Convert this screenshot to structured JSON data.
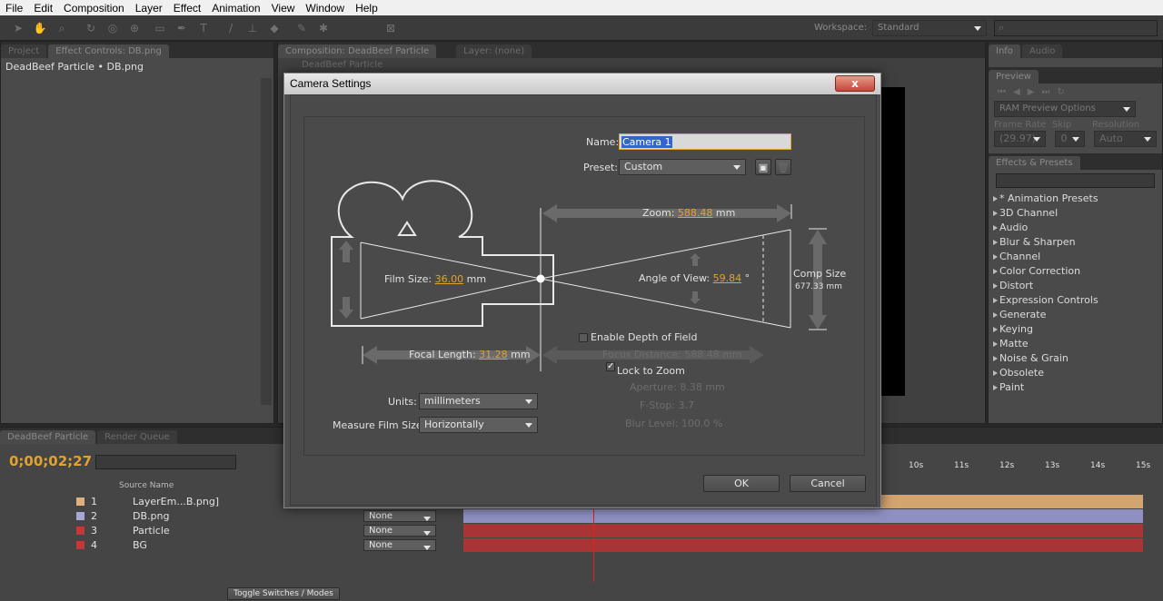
{
  "menu": [
    "File",
    "Edit",
    "Composition",
    "Layer",
    "Effect",
    "Animation",
    "View",
    "Window",
    "Help"
  ],
  "workspace": {
    "label": "Workspace:",
    "value": "Standard"
  },
  "left_panel": {
    "tabs": [
      "Project",
      "Effect Controls: DB.png"
    ],
    "header": "DeadBeef Particle • DB.png"
  },
  "comp_panel": {
    "tabs": [
      "Composition: DeadBeef Particle",
      "Layer: (none)"
    ],
    "subtitle": "DeadBeef Particle"
  },
  "right_panel": {
    "tabs": [
      "Info",
      "Audio"
    ],
    "preview_title": "Preview",
    "ram_preview": "RAM Preview Options",
    "frame_rate_label": "Frame Rate",
    "skip_label": "Skip",
    "resolution_label": "Resolution",
    "frame_rate": "(29.97)",
    "skip": "0",
    "resolution": "Auto",
    "effects_title": "Effects & Presets",
    "effects": [
      "* Animation Presets",
      "3D Channel",
      "Audio",
      "Blur & Sharpen",
      "Channel",
      "Color Correction",
      "Distort",
      "Expression Controls",
      "Generate",
      "Keying",
      "Matte",
      "Noise & Grain",
      "Obsolete",
      "Paint"
    ]
  },
  "dialog": {
    "title": "Camera Settings",
    "close": "x",
    "name_label": "Name:",
    "name_value": "Camera 1",
    "preset_label": "Preset:",
    "preset_value": "Custom",
    "zoom_label": "Zoom:",
    "zoom_value": "588.48",
    "zoom_unit": "mm",
    "film_size_label": "Film Size:",
    "film_size_value": "36.00",
    "film_size_unit": "mm",
    "angle_label": "Angle of View:",
    "angle_value": "59.84",
    "angle_unit": "°",
    "comp_size_label": "Comp Size",
    "comp_size_value": "677.33 mm",
    "enable_dof_label": "Enable Depth of Field",
    "enable_dof_checked": false,
    "focal_length_label": "Focal Length:",
    "focal_length_value": "31.28",
    "focal_length_unit": "mm",
    "focus_distance_label": "Focus Distance:",
    "focus_distance_value": "588.48 mm",
    "lock_zoom_label": "Lock to Zoom",
    "lock_zoom_checked": true,
    "aperture_label": "Aperture:",
    "aperture_value": "8.38 mm",
    "fstop_label": "F-Stop:",
    "fstop_value": "3.7",
    "blur_label": "Blur Level:",
    "blur_value": "100.0 %",
    "units_label": "Units:",
    "units_value": "millimeters",
    "measure_label": "Measure Film Size:",
    "measure_value": "Horizontally",
    "ok": "OK",
    "cancel": "Cancel"
  },
  "timeline": {
    "tabs": [
      "DeadBeef Particle",
      "Render Queue"
    ],
    "timecode": "0;00;02;27",
    "source_header": "Source Name",
    "ruler": [
      "10s",
      "11s",
      "12s",
      "13s",
      "14s",
      "15s"
    ],
    "toggle": "Toggle Switches / Modes",
    "layers": [
      {
        "num": "1",
        "name": "LayerEm...B.png]",
        "mode": "",
        "color": "#e0b080"
      },
      {
        "num": "2",
        "name": "DB.png",
        "mode": "None",
        "color": "#a7a7d4"
      },
      {
        "num": "3",
        "name": "Particle",
        "mode": "None",
        "color": "#c03a3a"
      },
      {
        "num": "4",
        "name": "BG",
        "mode": "None",
        "color": "#c03a3a"
      }
    ],
    "bar_colors": [
      "#d2a46e",
      "#8f8fc2",
      "#a83535",
      "#a83535"
    ]
  }
}
